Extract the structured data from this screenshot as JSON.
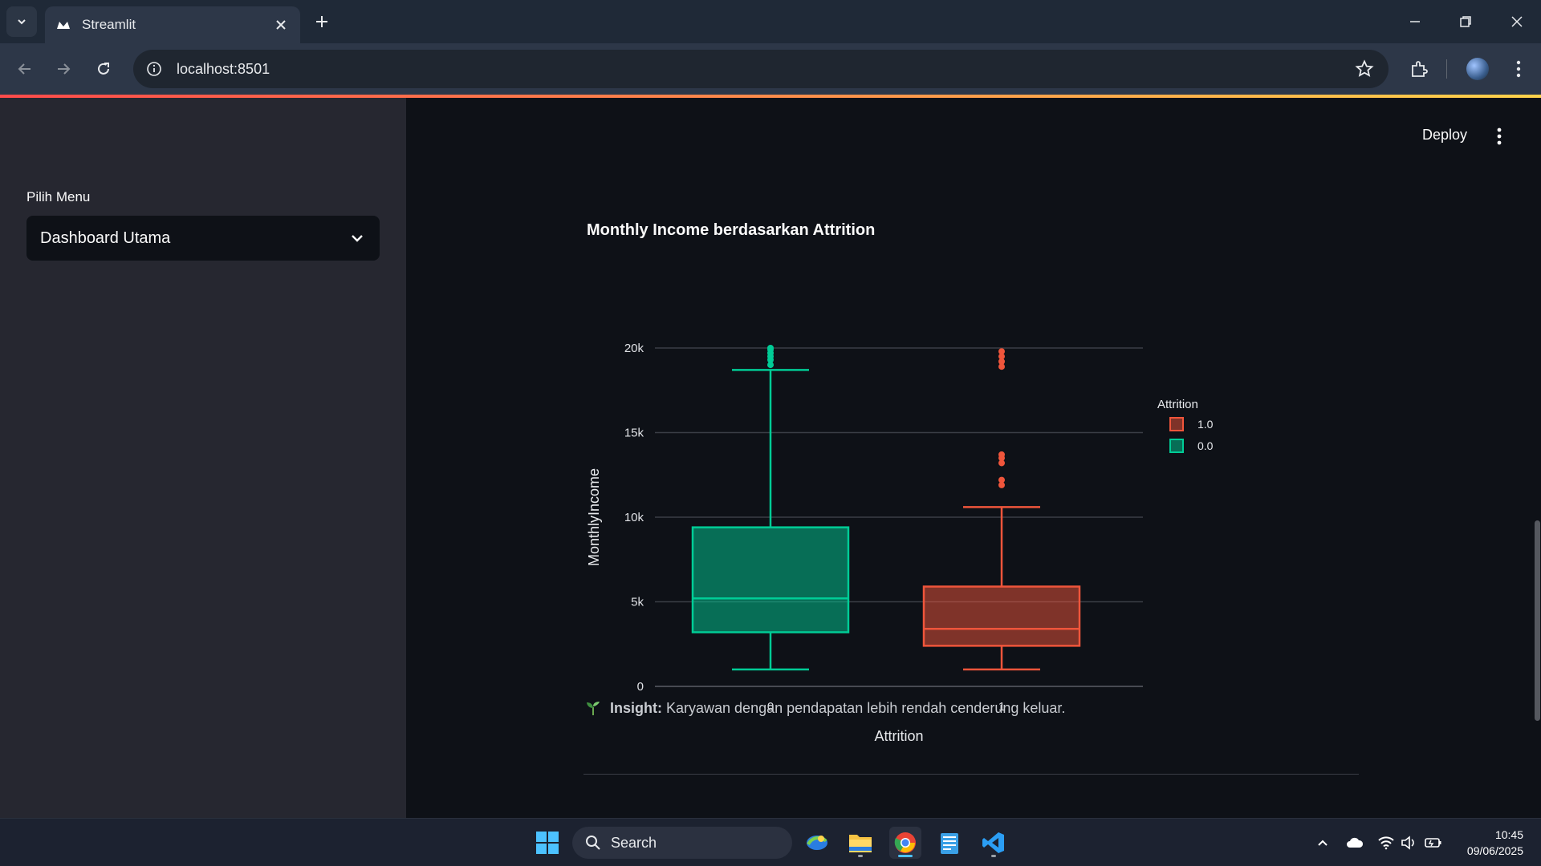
{
  "browser": {
    "tab_title": "Streamlit",
    "url": "localhost:8501"
  },
  "sidebar": {
    "menu_label": "Pilih Menu",
    "menu_selected": "Dashboard Utama"
  },
  "header": {
    "deploy_label": "Deploy"
  },
  "chart_title": "Monthly Income berdasarkan Attrition",
  "insight": {
    "label": "Insight:",
    "text": "Karyawan dengan pendapatan lebih rendah cenderung keluar."
  },
  "taskbar": {
    "search_label": "Search",
    "time": "10:45",
    "date": "09/06/2025"
  },
  "chart_data": {
    "type": "box",
    "title": "Monthly Income berdasarkan Attrition",
    "xlabel": "Attrition",
    "ylabel": "MonthlyIncome",
    "ylim": [
      0,
      20000
    ],
    "yticks": [
      0,
      5000,
      10000,
      15000,
      20000
    ],
    "ytick_labels": [
      "0",
      "5k",
      "10k",
      "15k",
      "20k"
    ],
    "categories": [
      "0",
      "1"
    ],
    "legend_title": "Attrition",
    "legend_position": "top-right",
    "grid": true,
    "series": [
      {
        "name": "0.0",
        "category": "0",
        "color": "#00cc96",
        "min": 1000,
        "q1": 3200,
        "median": 5200,
        "q3": 9400,
        "max": 18700,
        "outliers": [
          19000,
          19300,
          19500,
          19700,
          19900,
          20000
        ]
      },
      {
        "name": "1.0",
        "category": "1",
        "color": "#ef553b",
        "min": 1000,
        "q1": 2400,
        "median": 3400,
        "q3": 5900,
        "max": 10600,
        "outliers": [
          11900,
          12200,
          13200,
          13500,
          13700,
          18900,
          19200,
          19500,
          19800
        ]
      }
    ],
    "legend_order": [
      "1.0",
      "0.0"
    ]
  }
}
